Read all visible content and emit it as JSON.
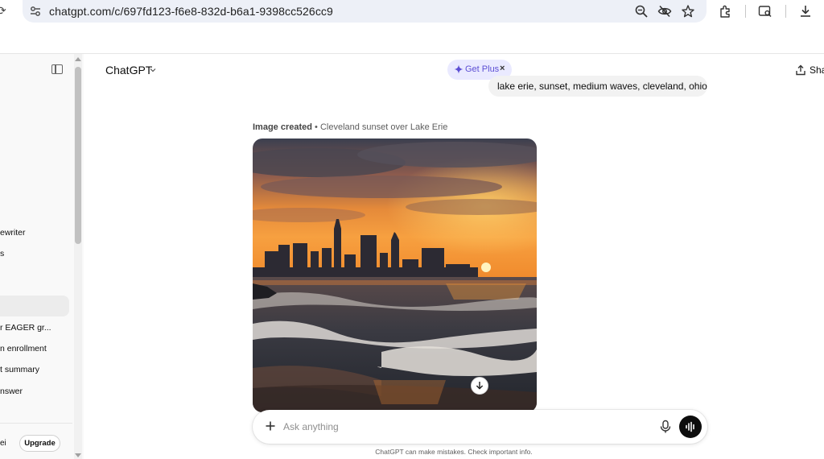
{
  "browser": {
    "url": "chatgpt.com/c/697fd123-f6e8-832d-b6a1-9398cc526cc9"
  },
  "sidebar": {
    "items": [
      {
        "label": "ewriter"
      },
      {
        "label": "s"
      },
      {
        "label": "r EAGER gr..."
      },
      {
        "label": "n enrollment"
      },
      {
        "label": "t summary"
      },
      {
        "label": "nswer"
      }
    ],
    "user_label": "ei",
    "upgrade_label": "Upgrade"
  },
  "header": {
    "model": "ChatGPT",
    "get_plus_label": "Get Plus",
    "get_plus_close": "×",
    "share_label": "Sha"
  },
  "conversation": {
    "user_message": "lake erie, sunset, medium waves, cleveland, ohio",
    "image_caption_prefix": "Image created",
    "image_caption_separator": " • ",
    "image_caption_title": "Cleveland sunset over Lake Erie"
  },
  "composer": {
    "placeholder": "Ask anything"
  },
  "disclaimer": "ChatGPT can make mistakes. Check important info.",
  "colors": {
    "plus_accent": "#5d4fd4",
    "plus_bg": "#eaeaff",
    "voice_button": "#0d0d0d"
  }
}
